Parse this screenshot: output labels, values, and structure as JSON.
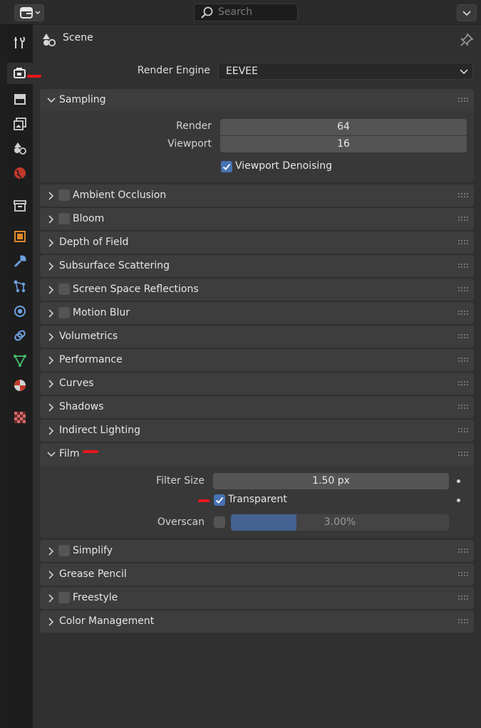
{
  "header": {
    "search_placeholder": "Search"
  },
  "tabs": [
    {
      "icon": "tool-icon"
    },
    {
      "icon": "render-icon",
      "active": true
    },
    {
      "icon": "output-icon"
    },
    {
      "icon": "view-layer-icon"
    },
    {
      "icon": "scene-icon"
    },
    {
      "icon": "world-icon"
    },
    {
      "icon": "collection-icon"
    },
    {
      "icon": "object-icon"
    },
    {
      "icon": "modifier-icon"
    },
    {
      "icon": "particles-icon"
    },
    {
      "icon": "physics-icon"
    },
    {
      "icon": "constraints-icon"
    },
    {
      "icon": "data-icon"
    },
    {
      "icon": "material-icon"
    },
    {
      "icon": "texture-icon"
    }
  ],
  "context": {
    "label": "Scene"
  },
  "render_engine": {
    "label": "Render Engine",
    "value": "EEVEE"
  },
  "sampling": {
    "title": "Sampling",
    "render_label": "Render",
    "render_value": "64",
    "viewport_label": "Viewport",
    "viewport_value": "16",
    "denoise_label": "Viewport Denoising"
  },
  "panels": {
    "ambient_occlusion": "Ambient Occlusion",
    "bloom": "Bloom",
    "depth_of_field": "Depth of Field",
    "subsurface": "Subsurface Scattering",
    "ssr": "Screen Space Reflections",
    "motion_blur": "Motion Blur",
    "volumetrics": "Volumetrics",
    "performance": "Performance",
    "curves": "Curves",
    "shadows": "Shadows",
    "indirect": "Indirect Lighting",
    "simplify": "Simplify",
    "grease_pencil": "Grease Pencil",
    "freestyle": "Freestyle",
    "color_management": "Color Management"
  },
  "film": {
    "title": "Film",
    "filter_label": "Filter Size",
    "filter_value": "1.50 px",
    "transparent_label": "Transparent",
    "overscan_label": "Overscan",
    "overscan_value": "3.00%",
    "overscan_fraction": 0.3
  },
  "colors": {
    "accent": "#4772b3",
    "annotation": "#e8171b"
  }
}
